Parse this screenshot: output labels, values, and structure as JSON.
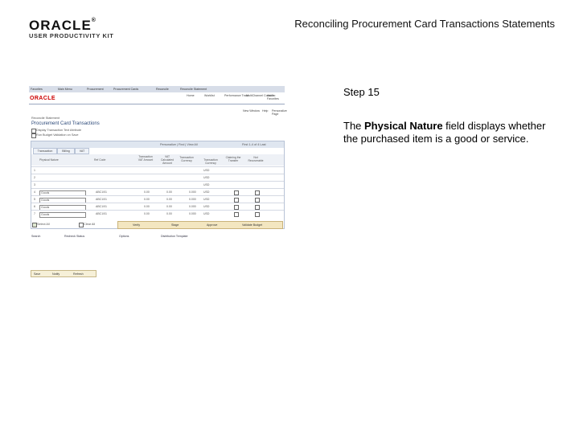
{
  "header": {
    "logo": "ORACLE",
    "logo_sub": "USER PRODUCTIVITY KIT",
    "doc_title": "Reconciling Procurement Card Transactions Statements"
  },
  "step": {
    "label": "Step 15",
    "desc_pre": "The ",
    "desc_bold": "Physical Nature",
    "desc_post": " field displays whether the purchased item is a good or service."
  },
  "screenshot": {
    "navbar": [
      "Favorites",
      "Main Menu",
      "Procurement",
      "Procurement Cards",
      "Reconcile",
      "Reconcile Statement"
    ],
    "logo": "ORACLE",
    "top_menu": [
      "Home",
      "Worklist",
      "Performance Trace",
      "MultiChannel Console",
      "Add to Favorites",
      "Sign out"
    ],
    "sub_menu": [
      "New Window",
      "Help",
      "Personalize Page"
    ],
    "breadcrumb": "Reconcile Statement",
    "title": "Procurement Card Transactions",
    "opt1": "Display Transaction Text Attribute",
    "opt2": "Run Budget Validation on Save",
    "find_bar": "Personalize | Find | View All",
    "paging": "First 1-4 of 4 Last",
    "tabs": [
      "Transaction",
      "Billing",
      "VAT"
    ],
    "columns": [
      "Physical Nature",
      "Ref Code",
      "Transaction VAT Amount",
      "VAT Calculated Amount",
      "Transaction Currency",
      "Transaction Currency",
      "Claiming the Transfer",
      "Not Recoverable"
    ],
    "rows": [
      {
        "num": "1",
        "nature": "",
        "ref": "",
        "a": "",
        "b": "",
        "c": "",
        "cur": "USD"
      },
      {
        "num": "2",
        "nature": "",
        "ref": "",
        "a": "",
        "b": "",
        "c": "",
        "cur": "USD"
      },
      {
        "num": "3",
        "nature": "",
        "ref": "",
        "a": "",
        "b": "",
        "c": "",
        "cur": "USD"
      },
      {
        "num": "4",
        "nature": "Goods",
        "ref": "ABC1/01",
        "a": "0.00",
        "b": "0.00",
        "c": "0.000",
        "cur": "USD"
      },
      {
        "num": "5",
        "nature": "Goods",
        "ref": "ABC1/01",
        "a": "0.00",
        "b": "0.00",
        "c": "0.000",
        "cur": "USD"
      },
      {
        "num": "6",
        "nature": "Goods",
        "ref": "ABC1/01",
        "a": "0.00",
        "b": "0.00",
        "c": "0.000",
        "cur": "USD"
      },
      {
        "num": "7",
        "nature": "Goods",
        "ref": "ABC1/01",
        "a": "0.00",
        "b": "0.00",
        "c": "0.000",
        "cur": "USD"
      }
    ],
    "select_all": "Select All",
    "clear_all": "Clear All",
    "buttons": [
      "Verify",
      "Stage",
      "Approve",
      "Validate Budget"
    ],
    "links": [
      "Search",
      "Recheck Status",
      "Options",
      "Distribution Template"
    ],
    "footer": [
      "Save",
      "Notify",
      "Refresh"
    ]
  }
}
